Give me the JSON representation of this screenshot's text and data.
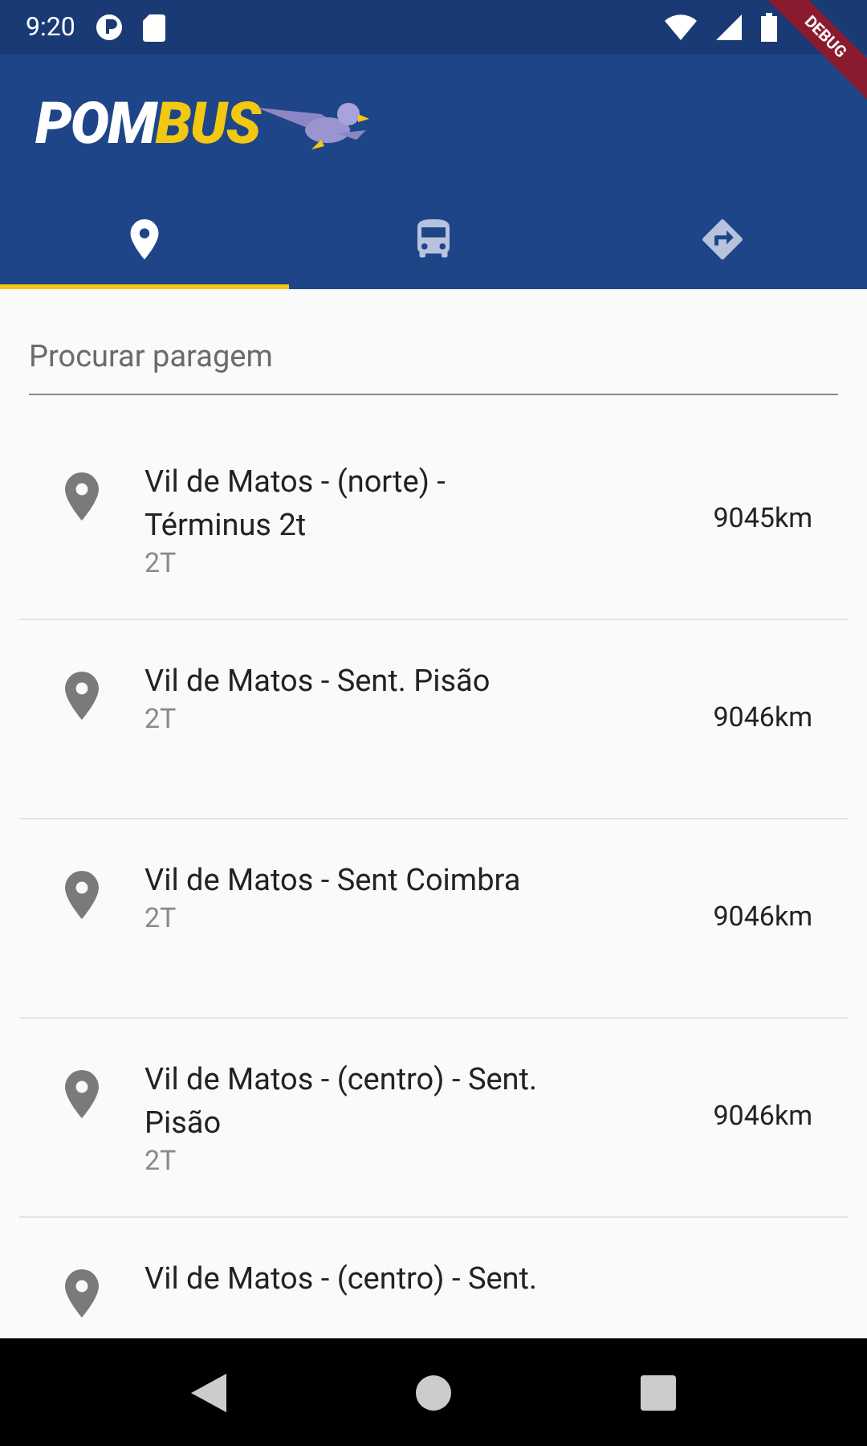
{
  "status_bar": {
    "time": "9:20"
  },
  "debug_banner": "DEBUG",
  "app_bar": {
    "logo_white": "POM",
    "logo_yellow": "BUS"
  },
  "tabs": [
    {
      "kind": "stop",
      "selected": true
    },
    {
      "kind": "bus",
      "selected": false
    },
    {
      "kind": "route",
      "selected": false
    }
  ],
  "search": {
    "placeholder": "Procurar paragem"
  },
  "stops": [
    {
      "name": "Vil de Matos - (norte) - Términus 2t",
      "code": "2T",
      "distance": "9045km"
    },
    {
      "name": "Vil de Matos - Sent. Pisão",
      "code": "2T",
      "distance": "9046km"
    },
    {
      "name": "Vil de Matos - Sent Coimbra",
      "code": "2T",
      "distance": "9046km"
    },
    {
      "name": "Vil de Matos - (centro) - Sent. Pisão",
      "code": "2T",
      "distance": "9046km"
    },
    {
      "name": "Vil de Matos - (centro) - Sent."
    }
  ]
}
